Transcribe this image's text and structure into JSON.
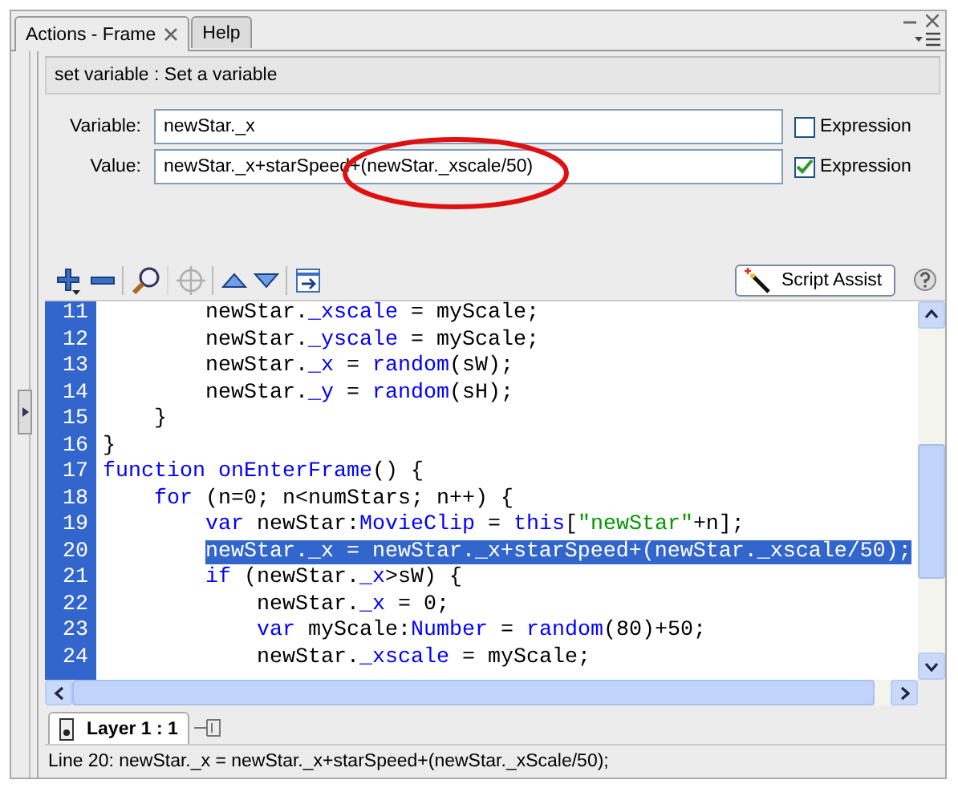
{
  "tabs": [
    {
      "label": "Actions - Frame",
      "selected": true,
      "closable": true
    },
    {
      "label": "Help",
      "selected": false,
      "closable": false
    }
  ],
  "header": "set variable : Set a variable",
  "fields": [
    {
      "label": "Variable:",
      "value": "newStar._x",
      "expression": false,
      "checkbox_label": "Expression"
    },
    {
      "label": "Value:",
      "value": "newStar._x+starSpeed+(newStar._xscale/50)",
      "expression": true,
      "checkbox_label": "Expression"
    }
  ],
  "toolbar": [
    {
      "kind": "add",
      "disabled": false
    },
    {
      "kind": "remove",
      "disabled": false
    },
    {
      "kind": "find",
      "disabled": false
    },
    {
      "kind": "target",
      "disabled": true
    },
    {
      "kind": "up",
      "disabled": false
    },
    {
      "kind": "down",
      "disabled": false
    },
    {
      "kind": "insert",
      "disabled": false
    }
  ],
  "script_assist": "Script Assist",
  "code": {
    "lines": [
      {
        "children": [
          {
            "children": [
              {
                "number": "11",
                "selected": false,
                "tokens": [
                  {
                    "kind": "plain",
                    "text": "newStar."
                  },
                  {
                    "kind": "keyword",
                    "text": "_xscale"
                  },
                  {
                    "kind": "plain",
                    "text": " = myScale;"
                  }
                ]
              },
              {
                "number": "12",
                "selected": false,
                "tokens": [
                  {
                    "kind": "plain",
                    "text": "newStar."
                  },
                  {
                    "kind": "keyword",
                    "text": "_yscale"
                  },
                  {
                    "kind": "plain",
                    "text": " = myScale;"
                  }
                ]
              },
              {
                "number": "13",
                "selected": false,
                "tokens": [
                  {
                    "kind": "plain",
                    "text": "newStar."
                  },
                  {
                    "kind": "keyword",
                    "text": "_x"
                  },
                  {
                    "kind": "plain",
                    "text": " = "
                  },
                  {
                    "kind": "keyword",
                    "text": "random"
                  },
                  {
                    "kind": "plain",
                    "text": "(sW);"
                  }
                ]
              },
              {
                "number": "14",
                "selected": false,
                "tokens": [
                  {
                    "kind": "plain",
                    "text": "newStar."
                  },
                  {
                    "kind": "keyword",
                    "text": "_y"
                  },
                  {
                    "kind": "plain",
                    "text": " = "
                  },
                  {
                    "kind": "keyword",
                    "text": "random"
                  },
                  {
                    "kind": "plain",
                    "text": "(sH);"
                  }
                ]
              }
            ]
          },
          {
            "number": "15",
            "selected": false,
            "tokens": [
              {
                "kind": "plain",
                "text": "}"
              }
            ]
          }
        ]
      },
      {
        "number": "16",
        "selected": false,
        "tokens": [
          {
            "kind": "plain",
            "text": "}"
          }
        ]
      },
      {
        "number": "17",
        "selected": false,
        "tokens": [
          {
            "kind": "keyword",
            "text": "function"
          },
          {
            "kind": "keyword",
            "text": "onEnterFrame"
          },
          {
            "kind": "plain",
            "text": "() {"
          }
        ],
        "children": [
          {
            "number": "18",
            "selected": false,
            "tokens": [
              {
                "kind": "keyword",
                "text": "for"
              },
              {
                "kind": "plain",
                "text": " (n=0; n<numStars; n++) {"
              }
            ],
            "children": [
              {
                "number": "19",
                "selected": false,
                "tokens": [
                  {
                    "kind": "keyword",
                    "text": "var"
                  },
                  {
                    "kind": "plain",
                    "text": " newStar:"
                  },
                  {
                    "kind": "keyword",
                    "text": "MovieClip"
                  },
                  {
                    "kind": "plain",
                    "text": " = "
                  },
                  {
                    "kind": "keyword",
                    "text": "this"
                  },
                  {
                    "kind": "plain",
                    "text": "["
                  },
                  {
                    "kind": "string",
                    "text": "\"newStar\""
                  },
                  {
                    "kind": "plain",
                    "text": "+n];"
                  }
                ]
              },
              {
                "number": "20",
                "selected": true,
                "tokens": [
                  {
                    "kind": "plain",
                    "text": "newStar._x = newStar._x+starSpeed+(newStar._xscale/50);"
                  }
                ]
              },
              {
                "number": "21",
                "selected": false,
                "tokens": [
                  {
                    "kind": "keyword",
                    "text": "if"
                  },
                  {
                    "kind": "plain",
                    "text": " (newStar."
                  },
                  {
                    "kind": "keyword",
                    "text": "_x"
                  },
                  {
                    "kind": "plain",
                    "text": ">sW) {"
                  }
                ],
                "children": [
                  {
                    "number": "22",
                    "selected": false,
                    "tokens": [
                      {
                        "kind": "plain",
                        "text": "newStar."
                      },
                      {
                        "kind": "keyword",
                        "text": "_x"
                      },
                      {
                        "kind": "plain",
                        "text": " = 0;"
                      }
                    ]
                  },
                  {
                    "number": "23",
                    "selected": false,
                    "tokens": [
                      {
                        "kind": "keyword",
                        "text": "var"
                      },
                      {
                        "kind": "plain",
                        "text": " myScale:"
                      },
                      {
                        "kind": "keyword",
                        "text": "Number"
                      },
                      {
                        "kind": "plain",
                        "text": " = "
                      },
                      {
                        "kind": "keyword",
                        "text": "random"
                      },
                      {
                        "kind": "plain",
                        "text": "(80)+50;"
                      }
                    ]
                  },
                  {
                    "number": "24",
                    "selected": false,
                    "tokens": [
                      {
                        "kind": "plain",
                        "text": "newStar."
                      },
                      {
                        "kind": "keyword",
                        "text": "_xscale"
                      },
                      {
                        "kind": "plain",
                        "text": " = myScale;"
                      }
                    ]
                  }
                ]
              }
            ]
          }
        ]
      }
    ]
  },
  "layer_tab": "Layer 1 : 1",
  "status_bar": "Line 20: newStar._x = newStar._x+starSpeed+(newStar._xScale/50);"
}
